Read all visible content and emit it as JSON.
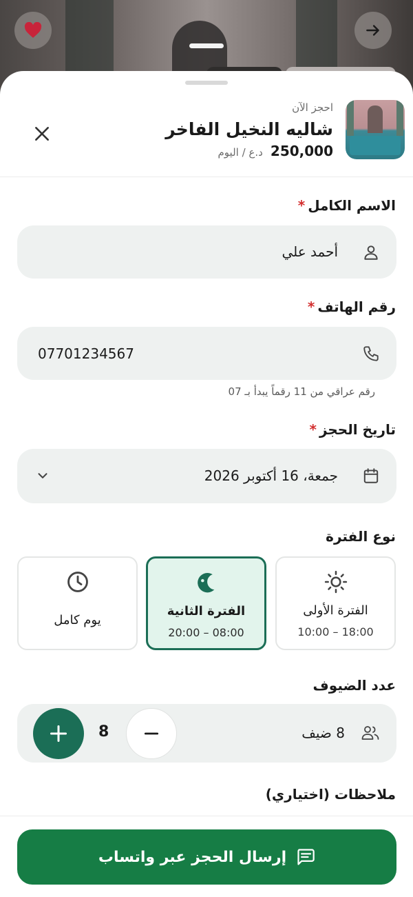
{
  "colors": {
    "brand_green": "#167d45",
    "accent_green": "#1b6e56",
    "selected_bg": "#e2f4ec",
    "required_star": "#d32f2f",
    "field_bg": "#eef1f0"
  },
  "top_actions": {
    "favorite_icon": "heart-icon",
    "forward_icon": "arrow-right-icon"
  },
  "header": {
    "subtitle": "احجز الآن",
    "title": "شاليه النخيل الفاخر",
    "price": "250,000",
    "price_unit": "د.ع / اليوم",
    "close_icon": "close-icon"
  },
  "form": {
    "name": {
      "label": "الاسم الكامل",
      "required_mark": "*",
      "value": "أحمد علي",
      "icon": "person-icon"
    },
    "phone": {
      "label": "رقم الهاتف",
      "required_mark": "*",
      "value": "07701234567",
      "hint": "رقم عراقي من 11 رقماً يبدأ بـ 07",
      "icon": "phone-icon"
    },
    "date": {
      "label": "تاريخ الحجز",
      "required_mark": "*",
      "value": "جمعة، 16 أكتوبر 2026",
      "icon": "calendar-icon"
    },
    "period": {
      "label": "نوع الفترة",
      "options": [
        {
          "title": "الفترة الأولى",
          "time": "10:00 – 18:00",
          "icon": "sun-icon",
          "selected": false
        },
        {
          "title": "الفترة الثانية",
          "time": "20:00 – 08:00",
          "icon": "moon-icon",
          "selected": true
        },
        {
          "title": "يوم كامل",
          "time": "",
          "icon": "clock-icon",
          "selected": false
        }
      ]
    },
    "guests": {
      "label": "عدد الضيوف",
      "count": "8",
      "summary": "8 ضيف",
      "icon": "people-icon"
    },
    "notes": {
      "label": "ملاحظات (اختياري)"
    }
  },
  "submit": {
    "label": "إرسال الحجز عبر واتساب",
    "icon": "message-icon"
  }
}
